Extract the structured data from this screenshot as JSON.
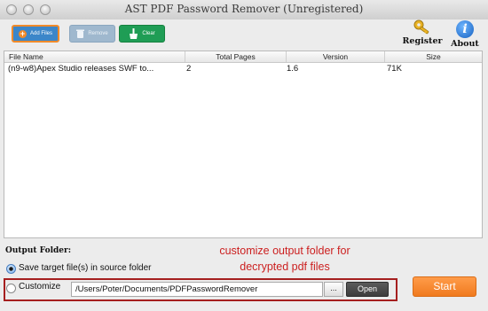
{
  "window": {
    "title": "AST PDF Password Remover (Unregistered)"
  },
  "toolbar": {
    "add_label": "Add Files",
    "remove_label": "Remove",
    "clear_label": "Clear",
    "register_label": "Register",
    "about_label": "About"
  },
  "table": {
    "columns": [
      "File Name",
      "Total Pages",
      "Version",
      "Size"
    ],
    "rows": [
      {
        "file_name": "(n9-w8)Apex Studio releases SWF to...",
        "total_pages": "2",
        "version": "1.6",
        "size": "71K"
      }
    ]
  },
  "output": {
    "heading": "Output Folder:",
    "option_source": "Save target file(s) in source folder",
    "option_custom": "Customize",
    "path": "/Users/Poter/Documents/PDFPasswordRemover",
    "browse_label": "...",
    "open_label": "Open"
  },
  "annotation": {
    "line1": "customize output folder for",
    "line2": "decrypted pdf files"
  },
  "start_label": "Start",
  "colors": {
    "accent_orange": "#f08a2a",
    "add_blue": "#3c86c9",
    "clear_green": "#1f9d55",
    "annotation_red": "#cc2020"
  }
}
